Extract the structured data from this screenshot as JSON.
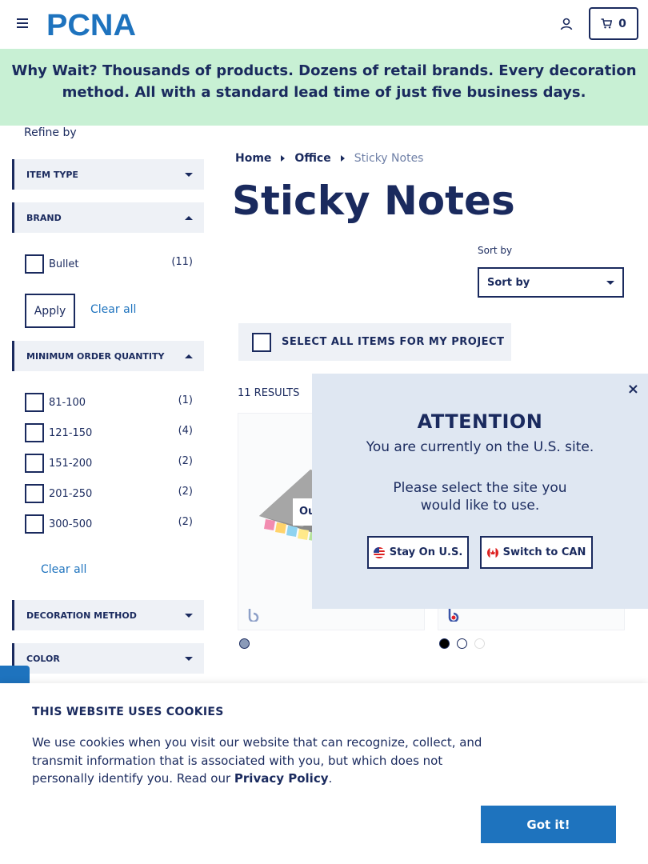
{
  "header": {
    "logo_text": "PCNA",
    "cart_count": "0"
  },
  "promo": {
    "lead": "Why Wait?",
    "text": " Thousands of products. Dozens of retail brands. Every decoration method. All with a standard lead time of just five business days."
  },
  "sidebar": {
    "refine_label": "Refine by",
    "facets": {
      "item_type": "ITEM TYPE",
      "brand": "BRAND",
      "moq": "MINIMUM ORDER QUANTITY",
      "decoration": "DECORATION METHOD",
      "color": "COLOR"
    },
    "brand_options": [
      {
        "label": "Bullet",
        "count": "(11)"
      }
    ],
    "apply_label": "Apply",
    "clear_all_label": "Clear all",
    "moq_options": [
      {
        "label": "81-100",
        "count": "(1)"
      },
      {
        "label": "121-150",
        "count": "(4)"
      },
      {
        "label": "151-200",
        "count": "(2)"
      },
      {
        "label": "201-250",
        "count": "(2)"
      },
      {
        "label": "300-500",
        "count": "(2)"
      }
    ]
  },
  "breadcrumb": {
    "home": "Home",
    "office": "Office",
    "current": "Sticky Notes"
  },
  "page_title": "Sticky Notes",
  "sort": {
    "label": "Sort by",
    "selected": "Sort by"
  },
  "select_all_label": "SELECT ALL ITEMS FOR MY PROJECT",
  "results_label": "11 RESULTS",
  "products": [
    {
      "tag": "Ou"
    }
  ],
  "modal": {
    "close": "×",
    "title": "ATTENTION",
    "message": "You are currently on the U.S. site.",
    "prompt": "Please select the site you would like to use.",
    "stay_label": "Stay On U.S.",
    "switch_label": "Switch to CAN"
  },
  "cookie": {
    "title": "THIS WEBSITE USES COOKIES",
    "text": "We use cookies when you visit our website that can recognize, collect, and transmit information that is associated with you, but which does not personally identify you. Read our ",
    "link": "Privacy Policy",
    "end": ".",
    "button": "Got it!"
  },
  "colors": {
    "navy": "#1a2a5e",
    "accent_blue": "#1e73be",
    "promo_green": "#c8f0d4",
    "modal_bg": "#dfe7f2"
  }
}
